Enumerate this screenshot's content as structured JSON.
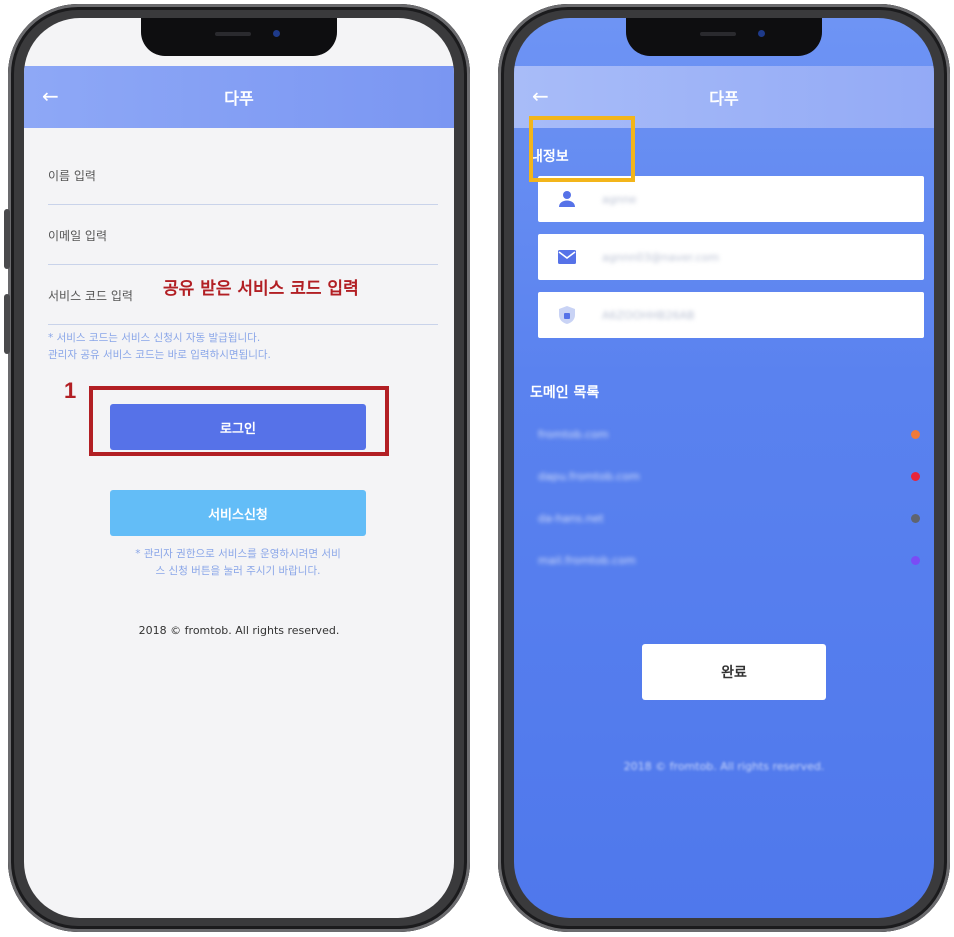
{
  "left_screen": {
    "app_title": "다푸",
    "back_icon": "arrow-left-icon",
    "name_field_label": "이름 입력",
    "email_field_label": "이메일 입력",
    "service_code_label": "서비스 코드 입력",
    "hint_line1": "* 서비스 코드는 서비스 신청시 자동 발급됩니다.",
    "hint_line2": "관리자 공유 서비스 코드는 바로 입력하시면됩니다.",
    "login_button": "로그인",
    "service_apply_button": "서비스신청",
    "notice_line1": "* 관리자 권한으로 서비스를 운영하시려면 서비",
    "notice_line2": "스 신청 버튼을 눌러 주시기 바랍니다.",
    "copyright": "2018 © fromtob. All rights reserved."
  },
  "right_screen": {
    "app_title": "다푸",
    "back_icon": "arrow-left-icon",
    "my_info_title": "내정보",
    "name_value": "agnne",
    "email_value": "agnnn03@naver.com",
    "code_value": "A6ZOOHHB26AB",
    "domain_list_title": "도메인 목록",
    "domains": [
      {
        "name": "fromtob.com",
        "color": "#f07a3a"
      },
      {
        "name": "dapu.fromtob.com",
        "color": "#e8243a"
      },
      {
        "name": "da-hans.net",
        "color": "#5f6470"
      },
      {
        "name": "mail.fromtob.com",
        "color": "#7a4cf5"
      }
    ],
    "done_button": "완료",
    "copyright": "2018 © fromtob. All rights reserved."
  },
  "annotations": {
    "step_number": "1",
    "service_code_callout": "공유 받은 서비스 코드 입력",
    "red_color": "#b21f24",
    "yellow_color": "#f3b51a"
  },
  "colors": {
    "login_button": "#5672e8",
    "service_button": "#63bdf7",
    "right_background": "#5a82ef"
  }
}
